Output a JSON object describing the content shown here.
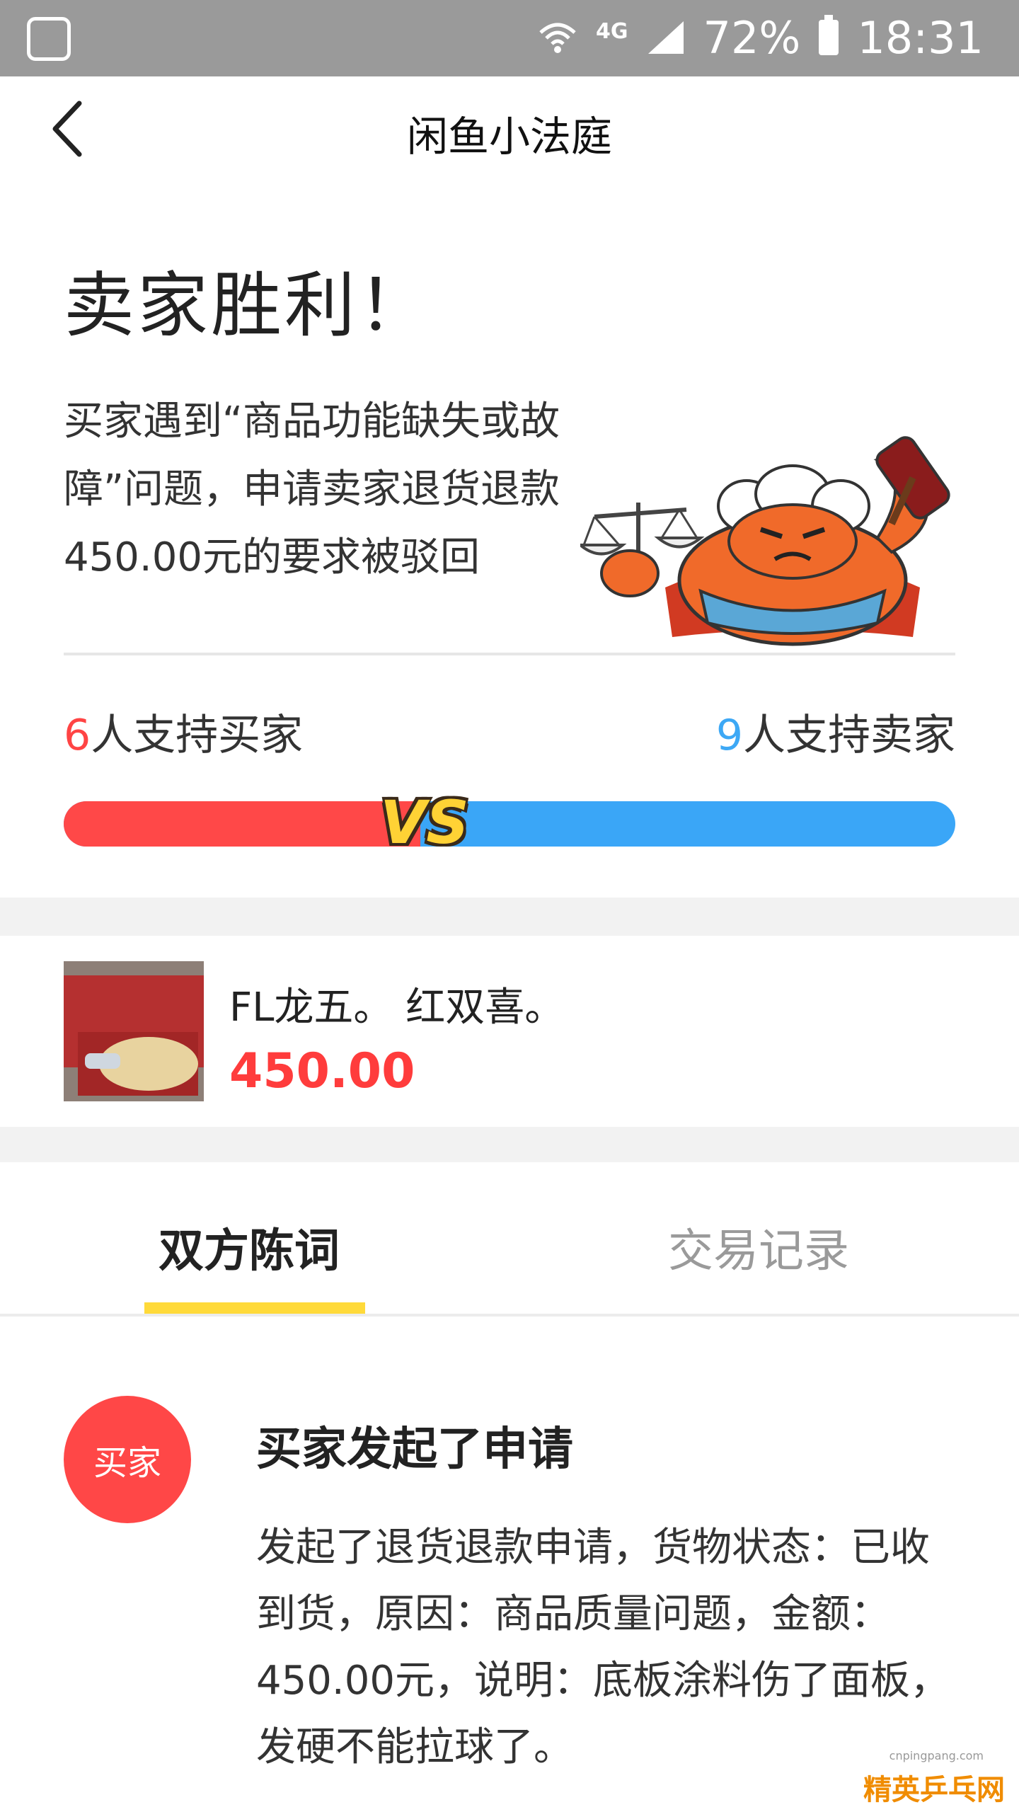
{
  "status_bar": {
    "network": "4G",
    "battery": "72%",
    "time": "18:31",
    "icons": [
      "baidu-app-icon",
      "wifi-icon",
      "signal-icon",
      "battery-icon"
    ]
  },
  "header": {
    "title": "闲鱼小法庭",
    "back_icon": "chevron-left-icon"
  },
  "verdict": {
    "title": "卖家胜利！",
    "description": "买家遇到“商品功能缺失或故障”问题，申请卖家退货退款450.00元的要求被驳回",
    "illustration": "crab-judge-with-gavel-and-scales"
  },
  "vote": {
    "buyer_count": "6",
    "buyer_label": "人支持买家",
    "seller_count": "9",
    "seller_label": "人支持卖家",
    "vs_label": "VS",
    "buyer_fraction": 0.4,
    "colors": {
      "buyer": "#ff4848",
      "seller": "#3aa6f7"
    }
  },
  "product": {
    "name": "FL龙五。 红双喜。",
    "price": "450.00"
  },
  "tabs": [
    {
      "label": "双方陈词",
      "active": true
    },
    {
      "label": "交易记录",
      "active": false
    }
  ],
  "event": {
    "avatar_label": "买家",
    "title": "买家发起了申请",
    "description": "发起了退货退款申请，货物状态：已收到货，原因：商品质量问题，金额：450.00元，说明：底板涂料伤了面板，发硬不能拉球了。"
  },
  "watermark": {
    "url": "cnpingpang.com",
    "text": "精英乒乓网"
  }
}
